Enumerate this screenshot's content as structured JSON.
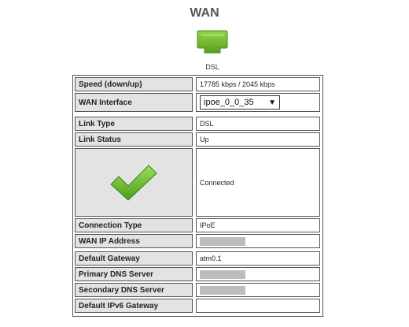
{
  "page": {
    "title": "WAN"
  },
  "connection_icon": {
    "label": "DSL",
    "status_color": "#6fb52c"
  },
  "rows": {
    "speed": {
      "label": "Speed (down/up)",
      "value": "17785 kbps / 2045 kbps"
    },
    "wan_interface": {
      "label": "WAN Interface",
      "selected": "ipoe_0_0_35"
    },
    "link_type": {
      "label": "Link Type",
      "value": "DSL"
    },
    "link_status": {
      "label": "Link Status",
      "value": "Up"
    },
    "connected": {
      "value": "Connected"
    },
    "connection_type": {
      "label": "Connection Type",
      "value": "IPoE"
    },
    "wan_ip": {
      "label": "WAN IP Address",
      "value": ""
    },
    "default_gateway": {
      "label": "Default Gateway",
      "value": "atm0.1"
    },
    "primary_dns": {
      "label": "Primary DNS Server",
      "value": ""
    },
    "secondary_dns": {
      "label": "Secondary DNS Server",
      "value": ""
    },
    "ipv6_gateway": {
      "label": "Default IPv6 Gateway",
      "value": ""
    }
  }
}
